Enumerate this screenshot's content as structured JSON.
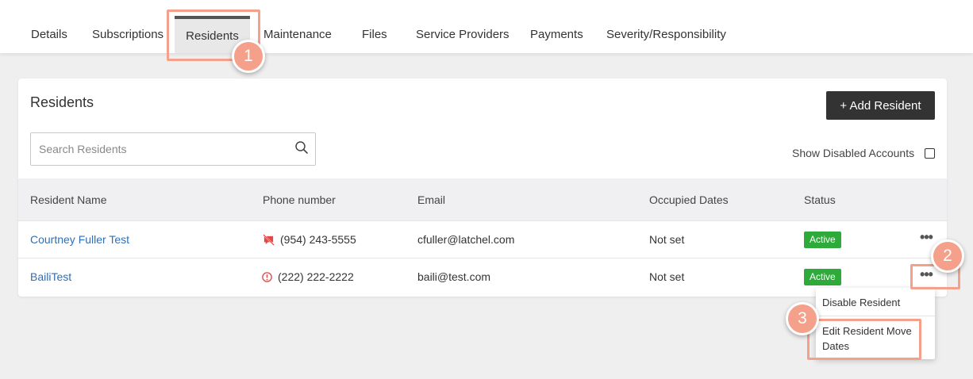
{
  "tabs": [
    {
      "label": "Details"
    },
    {
      "label": "Subscriptions"
    },
    {
      "label": "Residents"
    },
    {
      "label": "Maintenance"
    },
    {
      "label": "Files"
    },
    {
      "label": "Service Providers"
    },
    {
      "label": "Payments"
    },
    {
      "label": "Severity/Responsibility"
    }
  ],
  "active_tab": "Residents",
  "annotations": [
    "1",
    "2",
    "3"
  ],
  "panel": {
    "title": "Residents",
    "add_button": "+ Add Resident",
    "search_placeholder": "Search Residents",
    "search_value": "",
    "show_disabled_label": "Show Disabled Accounts",
    "show_disabled_checked": false
  },
  "table": {
    "columns": [
      "Resident Name",
      "Phone number",
      "Email",
      "Occupied Dates",
      "Status"
    ],
    "rows": [
      {
        "name": "Courtney Fuller Test",
        "phone": "(954) 243-5555",
        "phone_icon": "no-sms-icon",
        "email": "cfuller@latchel.com",
        "dates": "Not set",
        "status": "Active"
      },
      {
        "name": "BailiTest",
        "phone": "(222) 222-2222",
        "phone_icon": "warning-circle-icon",
        "email": "baili@test.com",
        "dates": "Not set",
        "status": "Active"
      }
    ]
  },
  "row_menu": {
    "items": [
      "Disable Resident",
      "Edit Resident Move Dates"
    ]
  },
  "colors": {
    "accent_highlight": "#f4a08a",
    "status_active": "#2eaa3a",
    "link": "#2f6fb5",
    "button_dark": "#333333",
    "alert_red": "#e04848"
  }
}
